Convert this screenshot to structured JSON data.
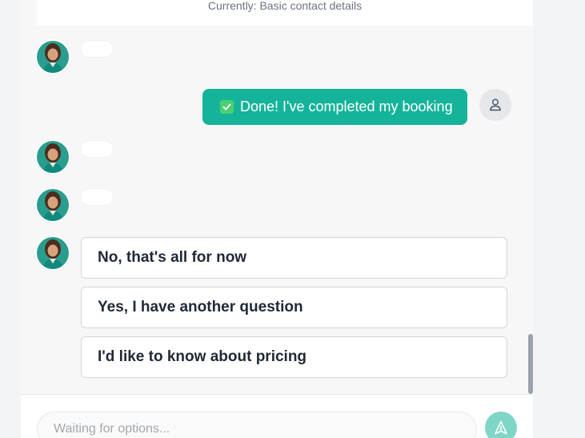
{
  "header": {
    "currently_text": "Currently: Basic contact details"
  },
  "messages": {
    "user_message": "Done! I've completed my booking",
    "check_icon": "check-box-icon"
  },
  "options": [
    {
      "label": "No, that's all for now"
    },
    {
      "label": "Yes, I have another question"
    },
    {
      "label": "I'd like to know about pricing"
    }
  ],
  "input": {
    "placeholder": "Waiting for options..."
  },
  "colors": {
    "accent": "#14b39a",
    "send_button": "#7fd6c7"
  }
}
